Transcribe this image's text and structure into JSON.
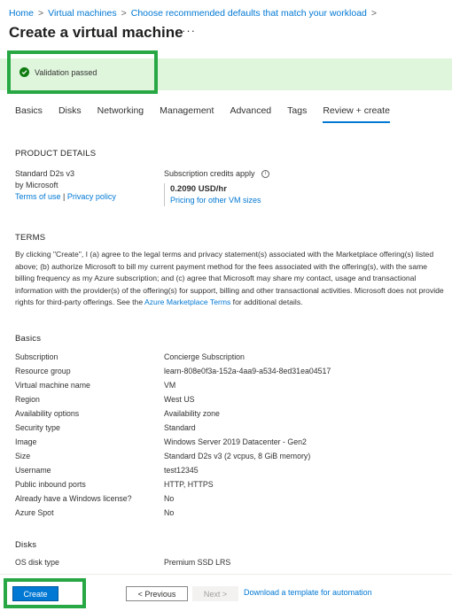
{
  "breadcrumb": [
    "Home",
    "Virtual machines",
    "Choose recommended defaults that match your workload"
  ],
  "breadcrumb_sep": ">",
  "title": "Create a virtual machine",
  "more": "···",
  "validation": {
    "text": "Validation passed",
    "status_color": "#107c10"
  },
  "tabs": [
    "Basics",
    "Disks",
    "Networking",
    "Management",
    "Advanced",
    "Tags",
    "Review + create"
  ],
  "active_tab": "Review + create",
  "product": {
    "heading": "PRODUCT DETAILS",
    "name": "Standard D2s v3",
    "publisher": "by Microsoft",
    "terms_link": "Terms of use",
    "pipe": "|",
    "privacy_link": "Privacy policy",
    "credits_label": "Subscription credits apply",
    "info": "i",
    "price": "0.2090 USD/hr",
    "pricing_link": "Pricing for other VM sizes"
  },
  "terms": {
    "heading": "TERMS",
    "text_before": "By clicking \"Create\", I (a) agree to the legal terms and privacy statement(s) associated with the Marketplace offering(s) listed above; (b) authorize Microsoft to bill my current payment method for the fees associated with the offering(s), with the same billing frequency as my Azure subscription; and (c) agree that Microsoft may share my contact, usage and transactional information with the provider(s) of the offering(s) for support, billing and other transactional activities. Microsoft does not provide rights for third-party offerings. See the ",
    "link": "Azure Marketplace Terms",
    "text_after": " for additional details."
  },
  "basics": {
    "heading": "Basics",
    "rows": [
      [
        "Subscription",
        "Concierge Subscription"
      ],
      [
        "Resource group",
        "learn-808e0f3a-152a-4aa9-a534-8ed31ea04517"
      ],
      [
        "Virtual machine name",
        "VM"
      ],
      [
        "Region",
        "West US"
      ],
      [
        "Availability options",
        "Availability zone"
      ],
      [
        "Security type",
        "Standard"
      ],
      [
        "Image",
        "Windows Server 2019 Datacenter - Gen2"
      ],
      [
        "Size",
        "Standard D2s v3 (2 vcpus, 8 GiB memory)"
      ],
      [
        "Username",
        "test12345"
      ],
      [
        "Public inbound ports",
        "HTTP, HTTPS"
      ],
      [
        "Already have a Windows license?",
        "No"
      ],
      [
        "Azure Spot",
        "No"
      ]
    ]
  },
  "disks": {
    "heading": "Disks",
    "rows": [
      [
        "OS disk type",
        "Premium SSD LRS"
      ]
    ]
  },
  "footer": {
    "create": "Create",
    "previous": "< Previous",
    "next": "Next >",
    "download": "Download a template for automation"
  },
  "colors": {
    "accent": "#0078d4",
    "highlight": "#27a844",
    "success_bg": "#dff6dd"
  }
}
